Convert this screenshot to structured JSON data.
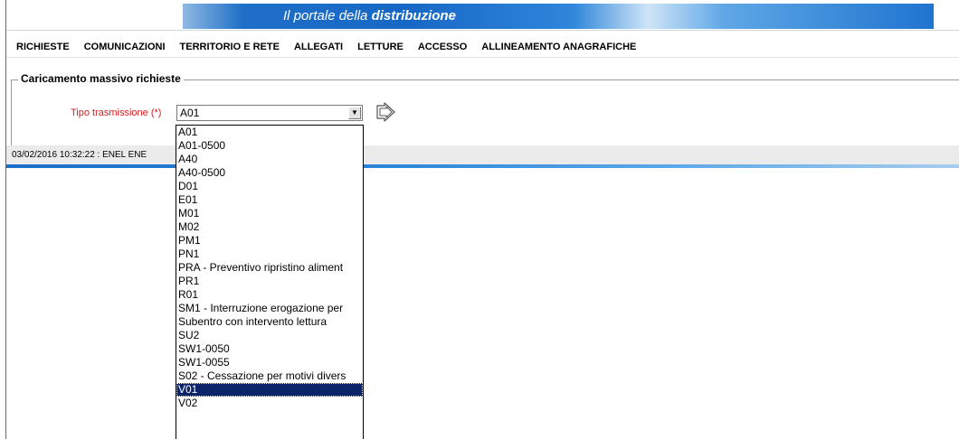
{
  "header": {
    "title_prefix": "Il portale della",
    "title_emphasis": "distribuzione"
  },
  "nav": {
    "items": [
      {
        "label": "RICHIESTE"
      },
      {
        "label": "COMUNICAZIONI"
      },
      {
        "label": "TERRITORIO E RETE"
      },
      {
        "label": "ALLEGATI"
      },
      {
        "label": "LETTURE"
      },
      {
        "label": "ACCESSO"
      },
      {
        "label": "ALLINEAMENTO ANAGRAFICHE"
      }
    ]
  },
  "form": {
    "legend": "Caricamento massivo richieste",
    "tipo_label": "Tipo trasmissione (*)",
    "tipo_selected": "A01",
    "dropdown_arrow_icon": "chevron-down-icon",
    "send_icon": "send-arrow-icon",
    "options": [
      "A01",
      "A01-0500",
      "A40",
      "A40-0500",
      "D01",
      "E01",
      "M01",
      "M02",
      "PM1",
      "PN1",
      "PRA - Preventivo ripristino aliment",
      "PR1",
      "R01",
      "SM1 - Interruzione erogazione per",
      "Subentro con intervento lettura",
      "SU2",
      "SW1-0050",
      "SW1-0055",
      "S02 - Cessazione per motivi divers",
      "V01",
      "V02"
    ],
    "highlighted_option": "V01"
  },
  "status": {
    "text": "03/02/2016 10:32:22  :  ENEL ENE"
  },
  "colors": {
    "banner_blue": "#1768c6",
    "label_red": "#d61e1e",
    "highlight": "#0b246a"
  }
}
